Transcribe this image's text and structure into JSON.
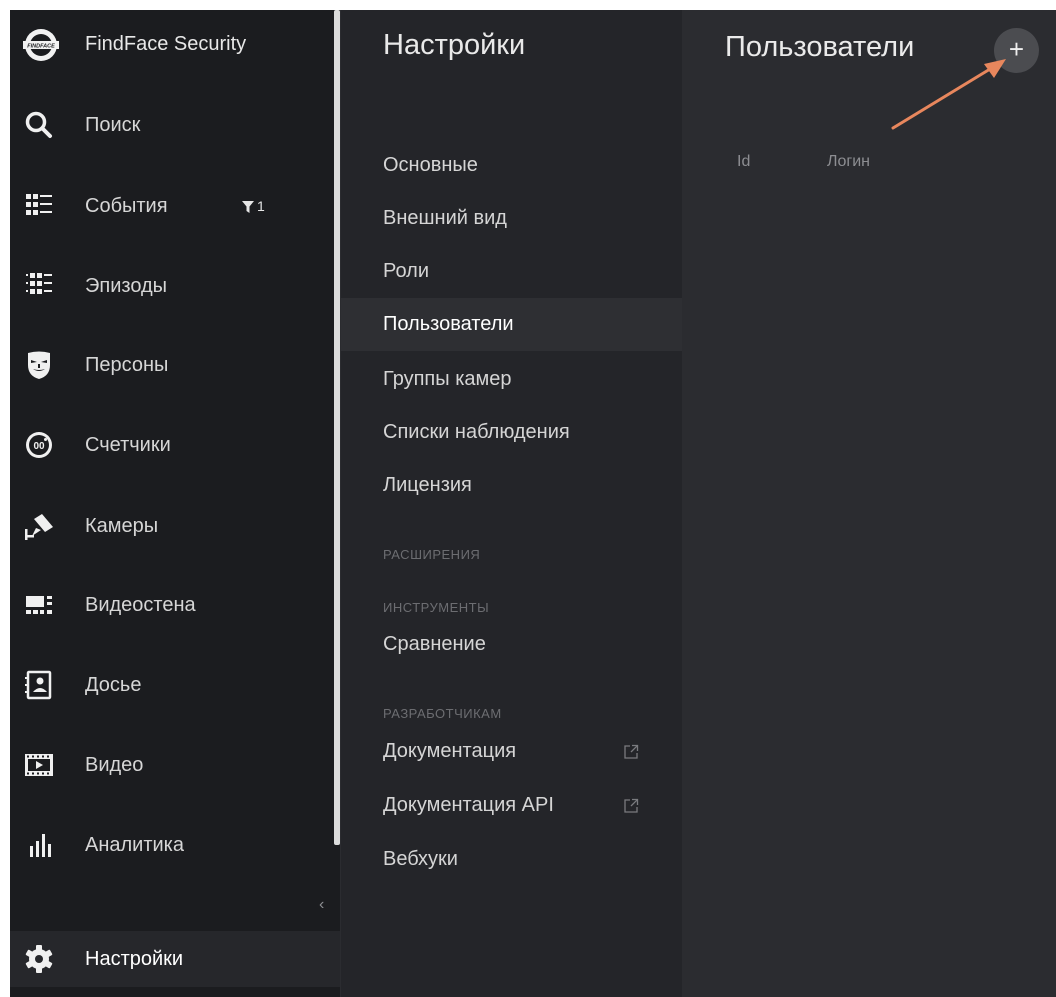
{
  "app": {
    "brand_name": "FindFace Security",
    "brand_logo_text": "FINDFACE"
  },
  "sidebar": {
    "items": [
      {
        "label": "Поиск",
        "icon": "search-icon"
      },
      {
        "label": "События",
        "icon": "events-icon",
        "filter_count": "1"
      },
      {
        "label": "Эпизоды",
        "icon": "episodes-icon"
      },
      {
        "label": "Персоны",
        "icon": "persons-icon"
      },
      {
        "label": "Счетчики",
        "icon": "counters-icon"
      },
      {
        "label": "Камеры",
        "icon": "camera-icon"
      },
      {
        "label": "Видеостена",
        "icon": "videowall-icon"
      },
      {
        "label": "Досье",
        "icon": "dossier-icon"
      },
      {
        "label": "Видео",
        "icon": "video-icon"
      },
      {
        "label": "Аналитика",
        "icon": "analytics-icon"
      }
    ],
    "collapse_glyph": "‹",
    "settings": {
      "label": "Настройки",
      "icon": "gear-icon",
      "active": true
    }
  },
  "settings_menu": {
    "title": "Настройки",
    "items": [
      {
        "label": "Основные"
      },
      {
        "label": "Внешний вид"
      },
      {
        "label": "Роли"
      },
      {
        "label": "Пользователи",
        "active": true
      },
      {
        "label": "Группы камер"
      },
      {
        "label": "Списки наблюдения"
      },
      {
        "label": "Лицензия"
      }
    ],
    "sections": {
      "extensions": "РАСШИРЕНИЯ",
      "tools": "ИНСТРУМЕНТЫ",
      "developers": "РАЗРАБОТЧИКАМ"
    },
    "tools_items": [
      {
        "label": "Сравнение"
      }
    ],
    "developer_items": [
      {
        "label": "Документация",
        "icon": "external-link-icon"
      },
      {
        "label": "Документация API",
        "icon": "external-link-icon"
      },
      {
        "label": "Вебхуки"
      }
    ]
  },
  "users": {
    "title": "Пользователи",
    "add_button": "+",
    "columns": {
      "id": "Id",
      "login": "Логин"
    }
  },
  "colors": {
    "annotation_arrow": "#e8875d",
    "sidebar_bg": "#1b1c1f",
    "menu_bg": "#242529",
    "panel_bg": "#2b2c30"
  }
}
